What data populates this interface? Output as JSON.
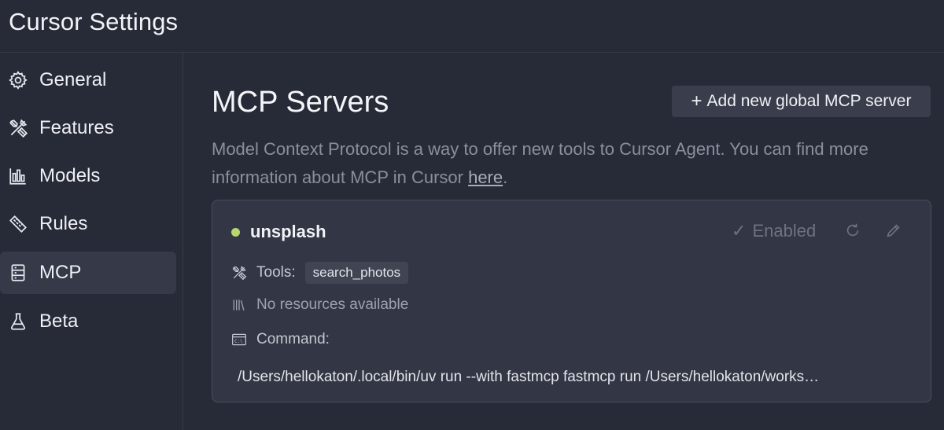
{
  "app": {
    "title": "Cursor Settings"
  },
  "sidebar": {
    "items": [
      {
        "label": "General",
        "icon": "gear-icon",
        "active": false
      },
      {
        "label": "Features",
        "icon": "tools-icon",
        "active": false
      },
      {
        "label": "Models",
        "icon": "bar-chart-icon",
        "active": false
      },
      {
        "label": "Rules",
        "icon": "ruler-icon",
        "active": false
      },
      {
        "label": "MCP",
        "icon": "server-icon",
        "active": true
      },
      {
        "label": "Beta",
        "icon": "flask-icon",
        "active": false
      }
    ]
  },
  "main": {
    "title": "MCP Servers",
    "add_button_label": "Add new global MCP server",
    "description": "Model Context Protocol is a way to offer new tools to Cursor Agent. You can find more information about MCP in Cursor ",
    "description_link": "here",
    "description_end": "."
  },
  "server": {
    "name": "unsplash",
    "status_color": "#b9d56f",
    "status_label": "Enabled",
    "tools_label": "Tools:",
    "tools": [
      "search_photos"
    ],
    "resources_label": "No resources available",
    "command_label": "Command:",
    "command": "/Users/hellokaton/.local/bin/uv run --with fastmcp fastmcp run /Users/hellokaton/works…"
  }
}
